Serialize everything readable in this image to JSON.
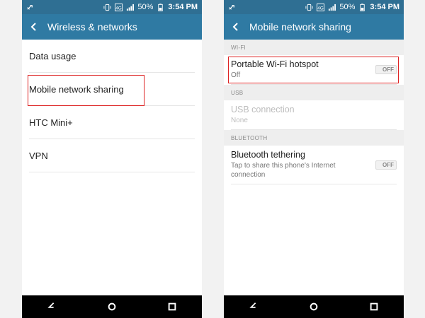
{
  "status": {
    "battery": "50%",
    "time": "3:54 PM"
  },
  "left_screen": {
    "title": "Wireless & networks",
    "items": [
      {
        "label": "Data usage"
      },
      {
        "label": "Mobile network sharing"
      },
      {
        "label": "HTC Mini+"
      },
      {
        "label": "VPN"
      }
    ]
  },
  "right_screen": {
    "title": "Mobile network sharing",
    "sections": [
      {
        "header": "WI-FI",
        "item": {
          "primary": "Portable Wi-Fi hotspot",
          "secondary": "Off",
          "toggle": "OFF"
        }
      },
      {
        "header": "USB",
        "item": {
          "primary": "USB connection",
          "secondary": "None"
        }
      },
      {
        "header": "BLUETOOTH",
        "item": {
          "primary": "Bluetooth tethering",
          "secondary": "Tap to share this phone's Internet connection",
          "toggle": "OFF"
        }
      }
    ]
  },
  "colors": {
    "statusbar": "#2f6f93",
    "appbar": "#2f7aa3",
    "highlight": "#dd2222",
    "navbar": "#000000"
  },
  "icons": [
    "usb-debug-icon",
    "vibrate-icon",
    "lte-icon",
    "signal-icon",
    "battery-icon",
    "back-arrow-icon",
    "back-icon",
    "home-icon",
    "recents-icon"
  ]
}
